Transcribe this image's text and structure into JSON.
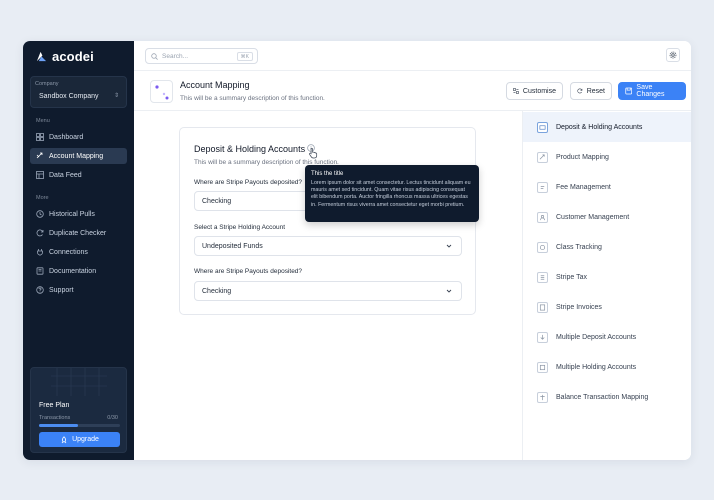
{
  "brand": {
    "name": "acodei"
  },
  "company": {
    "label": "Company",
    "value": "Sandbox Company"
  },
  "menu": {
    "label": "Menu",
    "items": [
      {
        "label": "Dashboard",
        "icon": "grid-icon"
      },
      {
        "label": "Account Mapping",
        "icon": "mapping-icon",
        "active": true
      },
      {
        "label": "Data Feed",
        "icon": "table-icon"
      }
    ]
  },
  "more": {
    "label": "More",
    "items": [
      {
        "label": "Historical Pulls",
        "icon": "clock-icon"
      },
      {
        "label": "Duplicate Checker",
        "icon": "refresh-icon"
      },
      {
        "label": "Connections",
        "icon": "plug-icon"
      },
      {
        "label": "Documentation",
        "icon": "book-icon"
      },
      {
        "label": "Support",
        "icon": "help-icon"
      }
    ]
  },
  "plan": {
    "title": "Free Plan",
    "transactions_label": "Transactions",
    "transactions_value": "0/30",
    "progress": 0.48,
    "upgrade_label": "Upgrade"
  },
  "search": {
    "placeholder": "Search...",
    "shortcut": "⌘K"
  },
  "header": {
    "title": "Account Mapping",
    "description": "This will be a summary description of this function.",
    "customise_label": "Customise",
    "reset_label": "Reset",
    "save_label": "Save Changes"
  },
  "card": {
    "title": "Deposit & Holding Accounts",
    "description": "This will be a summary description of this function.",
    "fields": [
      {
        "label": "Where are Stripe Payouts deposited?",
        "value": "Checking"
      },
      {
        "label": "Select a Stripe Holding Account",
        "value": "Undeposited Funds"
      },
      {
        "label": "Where are Stripe Payouts deposited?",
        "value": "Checking"
      }
    ]
  },
  "tooltip": {
    "title": "This the title",
    "body": "Lorem ipsum dolor sit amet consectetur. Lectus tincidunt aliquam eu mauris amet sed tincidunt. Quam vitae risus adipiscing consequat elit bibendum porta. Auctor fringilla rhoncus massa ultrices egestas in. Fermentum risus viverra amet consectetur eget morbi pretium."
  },
  "sections": [
    {
      "label": "Deposit & Holding Accounts",
      "active": true
    },
    {
      "label": "Product Mapping"
    },
    {
      "label": "Fee Management"
    },
    {
      "label": "Customer Management"
    },
    {
      "label": "Class Tracking"
    },
    {
      "label": "Stripe Tax"
    },
    {
      "label": "Stripe Invoices"
    },
    {
      "label": "Multiple Deposit Accounts"
    },
    {
      "label": "Multiple Holding Accounts"
    },
    {
      "label": "Balance Transaction Mapping"
    }
  ],
  "colors": {
    "accent": "#3b82f6",
    "sidebar": "#0f1b2d",
    "active_bg": "#eef3fb"
  }
}
